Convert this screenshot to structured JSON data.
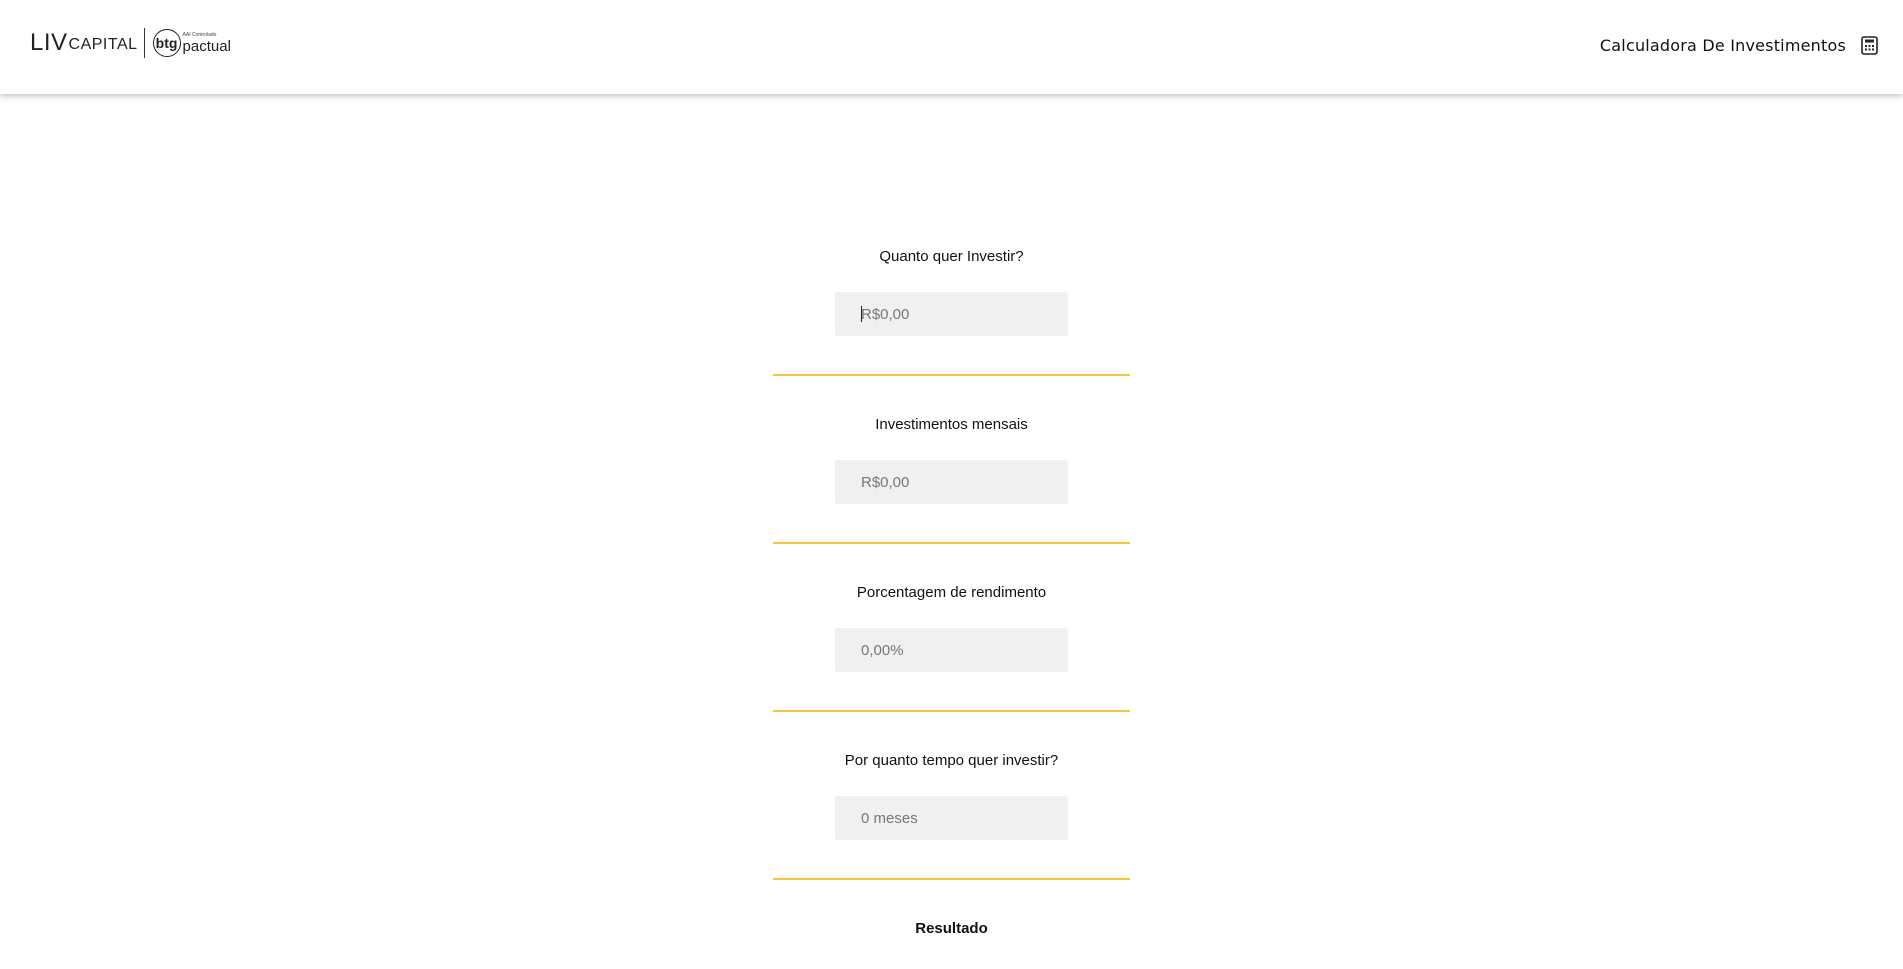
{
  "header": {
    "logo": {
      "liv": "LIV",
      "capital": "CAPITAL",
      "btg": "btg",
      "small_text": "AAI Controlado",
      "pactual": "pactual"
    },
    "title": "Calculadora De Investimentos",
    "icon": "calculator-icon"
  },
  "form": {
    "initial": {
      "label": "Quanto quer Investir?",
      "placeholder": "R$0,00"
    },
    "monthly": {
      "label": "Investimentos mensais",
      "placeholder": "R$0,00"
    },
    "rate": {
      "label": "Porcentagem de rendimento",
      "placeholder": "0,00%"
    },
    "period": {
      "label": "Por quanto tempo quer investir?",
      "placeholder": "0 meses"
    }
  },
  "result": {
    "label": "Resultado"
  },
  "colors": {
    "accent": "#f6c343",
    "field_background": "#f0f0f0"
  }
}
